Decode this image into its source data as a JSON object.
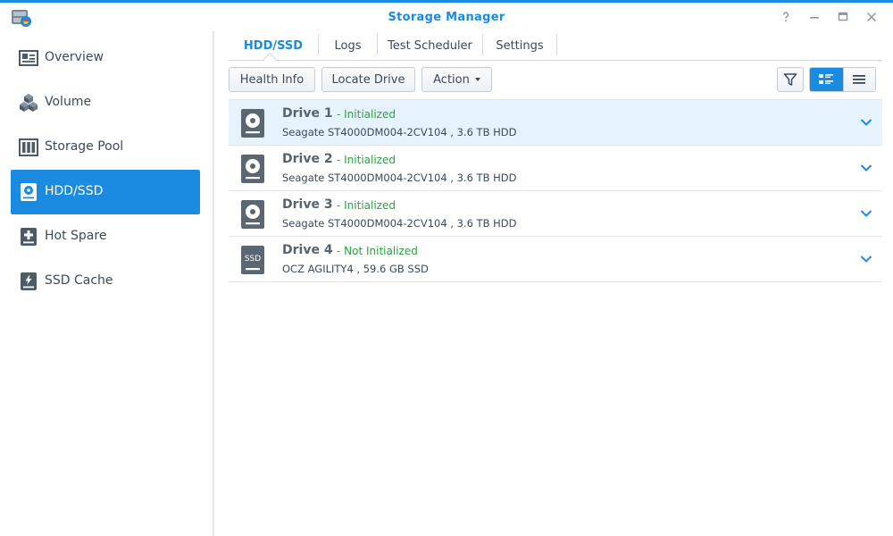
{
  "window": {
    "title": "Storage Manager"
  },
  "sidebar": {
    "items": [
      {
        "label": "Overview",
        "icon": "overview-icon",
        "active": false
      },
      {
        "label": "Volume",
        "icon": "volume-icon",
        "active": false
      },
      {
        "label": "Storage Pool",
        "icon": "storage-pool-icon",
        "active": false
      },
      {
        "label": "HDD/SSD",
        "icon": "hdd-icon",
        "active": true
      },
      {
        "label": "Hot Spare",
        "icon": "hot-spare-icon",
        "active": false
      },
      {
        "label": "SSD Cache",
        "icon": "ssd-cache-icon",
        "active": false
      }
    ]
  },
  "tabs": [
    {
      "label": "HDD/SSD",
      "active": true
    },
    {
      "label": "Logs",
      "active": false
    },
    {
      "label": "Test Scheduler",
      "active": false
    },
    {
      "label": "Settings",
      "active": false
    }
  ],
  "toolbar": {
    "health_info": "Health Info",
    "locate_drive": "Locate Drive",
    "action": "Action"
  },
  "drives": [
    {
      "name": "Drive 1",
      "status": "- Initialized",
      "desc": "Seagate ST4000DM004-2CV104 , 3.6 TB HDD",
      "type": "HDD",
      "selected": true
    },
    {
      "name": "Drive 2",
      "status": "- Initialized",
      "desc": "Seagate ST4000DM004-2CV104 , 3.6 TB HDD",
      "type": "HDD",
      "selected": false
    },
    {
      "name": "Drive 3",
      "status": "- Initialized",
      "desc": "Seagate ST4000DM004-2CV104 , 3.6 TB HDD",
      "type": "HDD",
      "selected": false
    },
    {
      "name": "Drive 4",
      "status": "- Not Initialized",
      "desc": "OCZ AGILITY4 , 59.6 GB SSD",
      "type": "SSD",
      "ssd_label": "SSD",
      "selected": false
    }
  ],
  "colors": {
    "accent": "#1a8be0",
    "status_ok": "#2ea043",
    "selected_row": "#e6f3fc"
  }
}
